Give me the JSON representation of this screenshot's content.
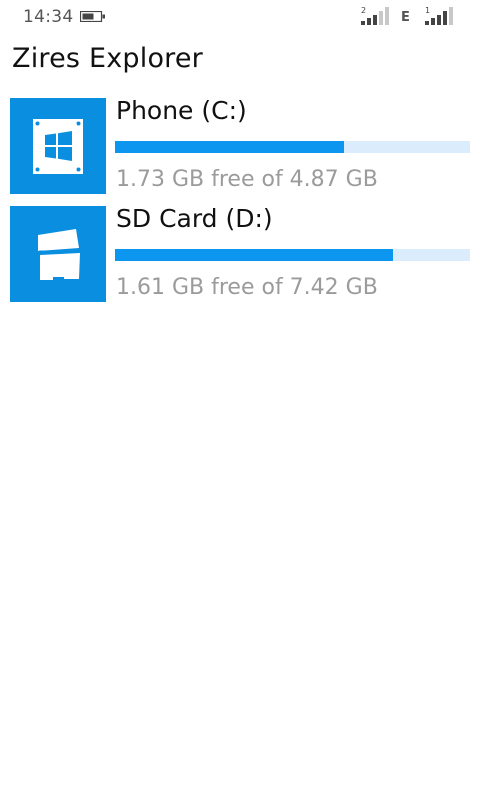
{
  "status_bar": {
    "time": "14:34",
    "sim1_label": "2",
    "network_type": "E",
    "sim2_label": "1"
  },
  "app": {
    "title": "Zires Explorer"
  },
  "drives": [
    {
      "name": "Phone (C:)",
      "space_text": "1.73 GB free of 4.87 GB",
      "icon": "windows-drive-icon",
      "used_fraction": 0.645
    },
    {
      "name": "SD Card (D:)",
      "space_text": "1.61 GB free of 7.42 GB",
      "icon": "sd-card-icon",
      "used_fraction": 0.783
    }
  ],
  "colors": {
    "accent": "#0a8fe0",
    "bar_fill": "#0d96ef",
    "bar_track": "#dbedfc",
    "secondary_text": "#9b9b9b"
  }
}
